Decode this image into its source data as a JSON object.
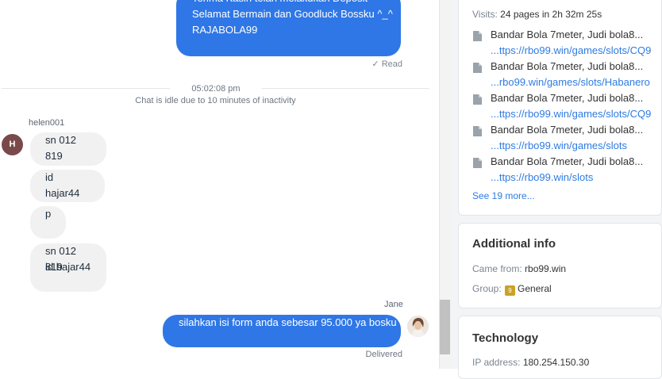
{
  "chat": {
    "agent_message_1": [
      "Terima Kasih telah melakukan Deposit",
      "Selamat Bermain dan Goodluck Bossku ^_^",
      "RAJABOLA99"
    ],
    "read_status": "Read",
    "divider_time": "05:02:08 pm",
    "idle_note": "Chat is idle due to 10 minutes of inactivity",
    "visitor_name": "helen001",
    "visitor_initial": "H",
    "visitor_messages": [
      [
        "sn 012 819"
      ],
      [
        "id hajar44"
      ],
      [
        "p"
      ],
      [
        "sn 012 819",
        "id hajar44"
      ]
    ],
    "agent_name": "Jane",
    "agent_message_2": "silahkan isi form anda sebesar 95.000 ya bosku",
    "delivered_status": "Delivered"
  },
  "visits": {
    "label": "Visits:",
    "value": "24 pages in 2h 32m 25s",
    "pages": [
      {
        "title": "Bandar Bola 7meter, Judi bola8...",
        "url": "...ttps://rbo99.win/games/slots/CQ9"
      },
      {
        "title": "Bandar Bola 7meter, Judi bola8...",
        "url": "...rbo99.win/games/slots/Habanero"
      },
      {
        "title": "Bandar Bola 7meter, Judi bola8...",
        "url": "...ttps://rbo99.win/games/slots/CQ9"
      },
      {
        "title": "Bandar Bola 7meter, Judi bola8...",
        "url": "...ttps://rbo99.win/games/slots"
      },
      {
        "title": "Bandar Bola 7meter, Judi bola8...",
        "url": "...ttps://rbo99.win/slots"
      }
    ],
    "see_more": "See 19 more..."
  },
  "additional_info": {
    "heading": "Additional info",
    "came_from_label": "Came from:",
    "came_from_value": "rbo99.win",
    "group_label": "Group:",
    "group_badge": "9",
    "group_value": "General"
  },
  "technology": {
    "heading": "Technology",
    "ip_label": "IP address:",
    "ip_value": "180.254.150.30"
  },
  "icons": {
    "page": "document-icon",
    "read": "checkmark-icon"
  },
  "colors": {
    "agent_bubble": "#2f77e6",
    "visitor_bubble": "#f1f1f1",
    "link": "#2e7be2",
    "group_badge": "#c9a227"
  }
}
